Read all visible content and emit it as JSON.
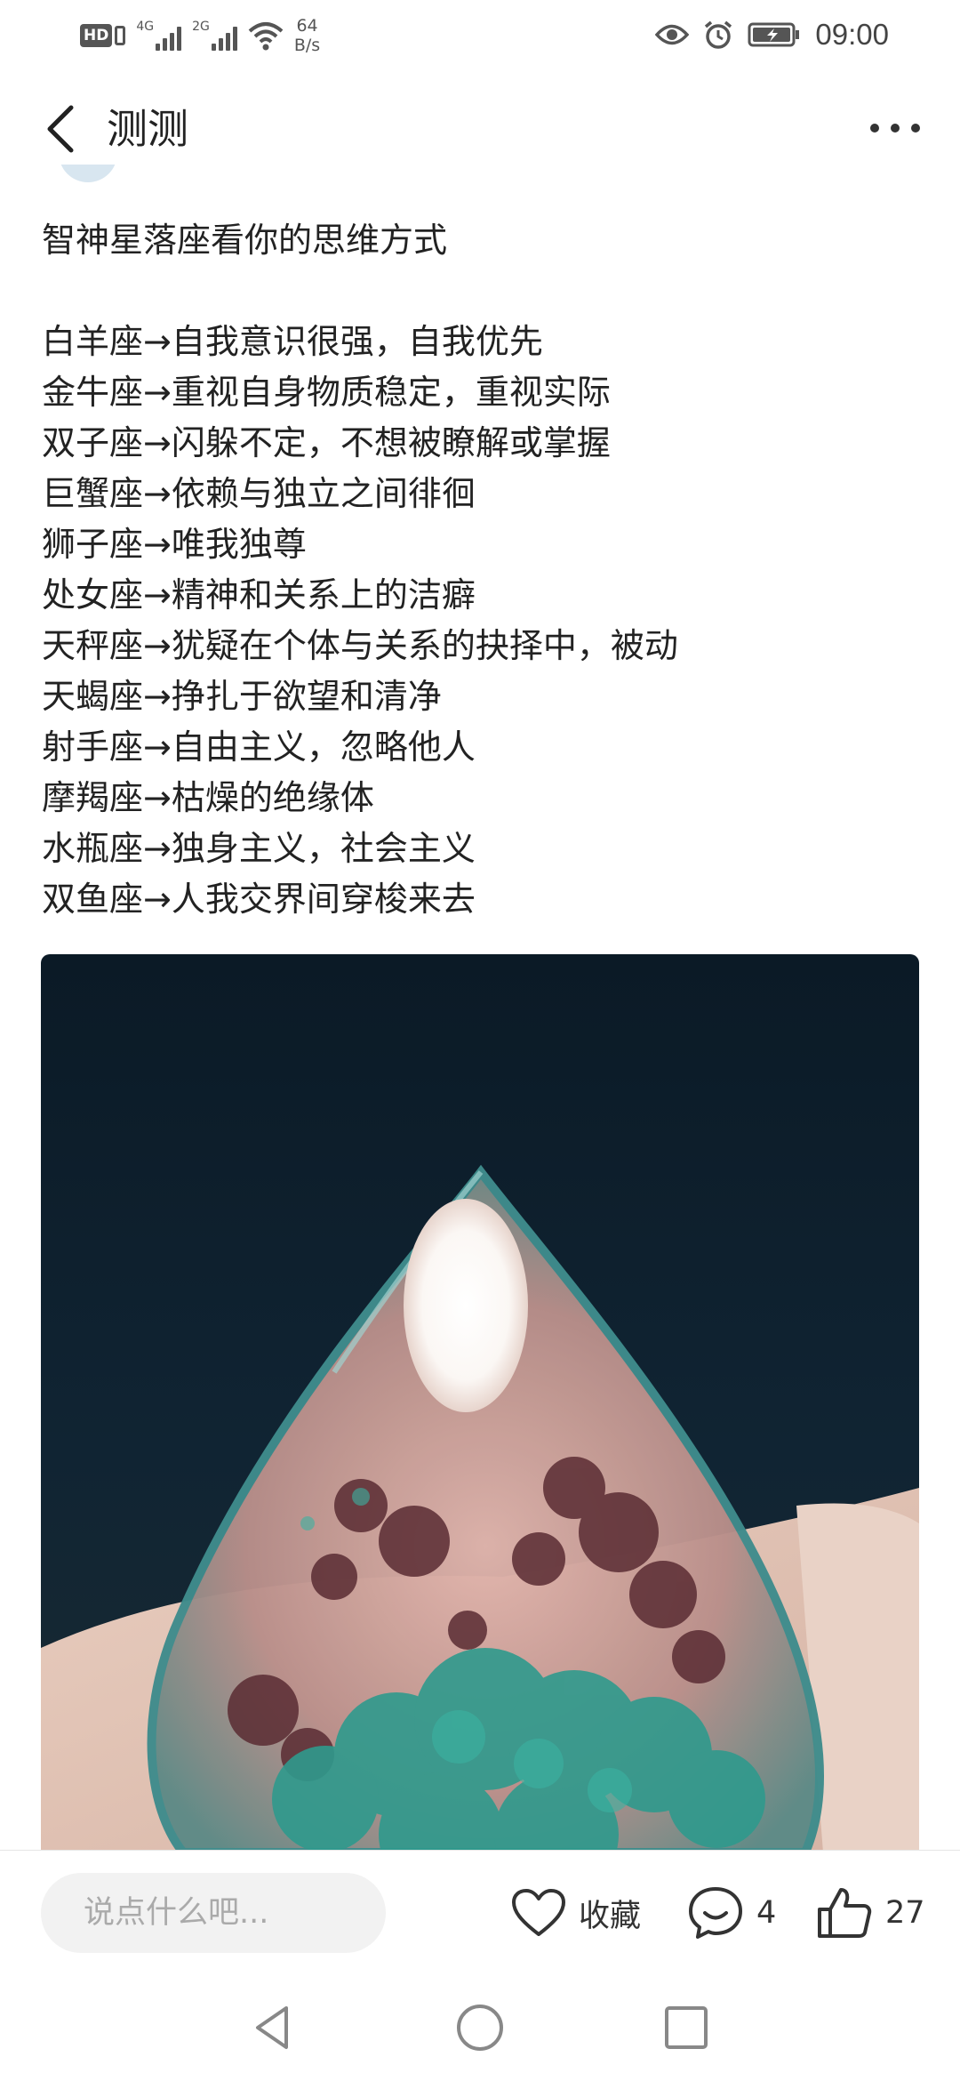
{
  "status_bar": {
    "hd_label": "HD",
    "signal1_label": "4G",
    "signal2_label": "2G",
    "speed_value": "64",
    "speed_unit": "B/s",
    "time": "09:00"
  },
  "header": {
    "title": "测测"
  },
  "post": {
    "title": "智神星落座看你的思维方式",
    "lines": [
      "白羊座→自我意识很强，自我优先",
      "金牛座→重视自身物质稳定，重视实际",
      "双子座→闪躲不定，不想被瞭解或掌握",
      "巨蟹座→依赖与独立之间徘徊",
      "狮子座→唯我独尊",
      "处女座→精神和关系上的洁癖",
      "天秤座→犹疑在个体与关系的抉择中，被动",
      "天蝎座→挣扎于欲望和清净",
      "射手座→自由主义，忽略他人",
      "摩羯座→枯燥的绝缘体",
      "水瓶座→独身主义，社会主义",
      "双鱼座→人我交界间穿梭来去"
    ]
  },
  "bottom_bar": {
    "comment_placeholder": "说点什么吧...",
    "favorite_label": "收藏",
    "comment_count": "4",
    "like_count": "27"
  },
  "colors": {
    "text": "#222222",
    "icon": "#333333",
    "input_bg": "#f2f2f2"
  }
}
